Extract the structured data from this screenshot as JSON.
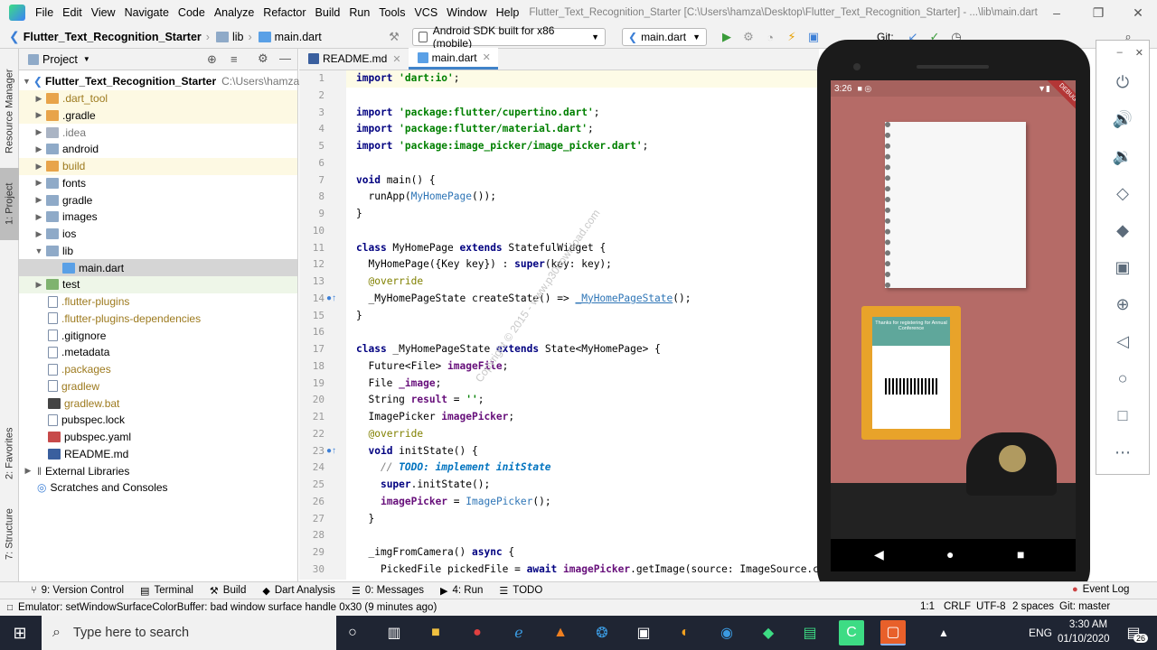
{
  "menubar": {
    "items": [
      "File",
      "Edit",
      "View",
      "Navigate",
      "Code",
      "Analyze",
      "Refactor",
      "Build",
      "Run",
      "Tools",
      "VCS",
      "Window",
      "Help"
    ],
    "title": "Flutter_Text_Recognition_Starter [C:\\Users\\hamza\\Desktop\\Flutter_Text_Recognition_Starter] - ...\\lib\\main.dart"
  },
  "navbar": {
    "project": "Flutter_Text_Recognition_Starter",
    "folder": "lib",
    "file": "main.dart",
    "device": "Android SDK built for x86 (mobile)",
    "run_config": "main.dart",
    "git_label": "Git:"
  },
  "left_stripe": {
    "resource_manager": "Resource Manager",
    "project": "1: Project",
    "favorites": "2: Favorites",
    "structure": "7: Structure"
  },
  "project_panel": {
    "header": "Project",
    "root_name": "Flutter_Text_Recognition_Starter",
    "root_path": "C:\\Users\\hamza\\De",
    "items": [
      ".dart_tool",
      ".gradle",
      ".idea",
      "android",
      "build",
      "fonts",
      "gradle",
      "images",
      "ios",
      "lib",
      "main.dart",
      "test",
      ".flutter-plugins",
      ".flutter-plugins-dependencies",
      ".gitignore",
      ".metadata",
      ".packages",
      "gradlew",
      "gradlew.bat",
      "pubspec.lock",
      "pubspec.yaml",
      "README.md",
      "External Libraries",
      "Scratches and Consoles"
    ]
  },
  "editor": {
    "tabs": [
      "README.md",
      "main.dart"
    ],
    "line_numbers": [
      "1",
      "2",
      "3",
      "4",
      "5",
      "6",
      "7",
      "8",
      "9",
      "10",
      "11",
      "12",
      "13",
      "14",
      "15",
      "16",
      "17",
      "18",
      "19",
      "20",
      "21",
      "22",
      "23",
      "24",
      "25",
      "26",
      "27",
      "28",
      "29",
      "30"
    ],
    "tok": {
      "import": "import ",
      "s1": "'dart:io'",
      "semi": ";",
      "s3": "'package:flutter/cupertino.dart'",
      "s4": "'package:flutter/material.dart'",
      "s5": "'package:image_picker/image_picker.dart'",
      "void": "void ",
      "main": "main() {",
      "runApp": "  runApp(",
      "myHomePage": "MyHomePage",
      "runAppEnd": "());",
      "closeBrace": "}",
      "class": "class ",
      "myHomePageDecl": "MyHomePage ",
      "extends": "extends ",
      "statefulWidget": "StatefulWidget {",
      "l12a": "  MyHomePage({Key key}) : ",
      "super": "super",
      "l12b": "(key: key);",
      "override": "@override",
      "l14a": "  _MyHomePageState createState() => ",
      "l14b": "_MyHomePageState",
      "l14c": "();",
      "stateDecl": "_MyHomePageState ",
      "stateType": "State<MyHomePage> {",
      "l18a": "  Future<File> ",
      "imageFile": "imageFile",
      "l19a": "  File ",
      "image": "_image",
      "l20a": "  String ",
      "result": "result",
      "l20b": " = ",
      "emptyStr": "''",
      "l21a": "  ImagePicker ",
      "imagePicker": "imagePicker",
      "initState": "initState() {",
      "l24": "    // ",
      "todo": "TODO: implement initState",
      "l25a": "    ",
      "l25b": ".initState();",
      "l26b": " = ",
      "imagePickerCls": "ImagePicker",
      "l26c": "();",
      "closeBrace2": "  }",
      "l29": "  _imgFromCamera() ",
      "async": "async",
      "l29b": " {",
      "l30a": "    PickedFile pickedFile = ",
      "await": "await ",
      "l30b": ".getImage(source: ImageSource.cam"
    },
    "watermark": "Copyright © 2015 - www.p30download.com"
  },
  "emulator": {
    "time": "3:26",
    "debug_ribbon": "DEBUG",
    "card_title": "Thanks for registering for Annual Conference"
  },
  "toolwindows": [
    "9: Version Control",
    "Terminal",
    "Build",
    "Dart Analysis",
    "0: Messages",
    "4: Run",
    "TODO",
    "Event Log"
  ],
  "status": {
    "message": "Emulator: setWindowSurfaceColorBuffer: bad window surface handle 0x30 (9 minutes ago)",
    "position": "1:1",
    "line_sep": "CRLF",
    "encoding": "UTF-8",
    "indent": "2 spaces",
    "git": "Git: master"
  },
  "taskbar": {
    "search_placeholder": "Type here to search",
    "lang": "ENG",
    "time": "3:30 AM",
    "date": "01/10/2020",
    "notif_count": "26"
  }
}
